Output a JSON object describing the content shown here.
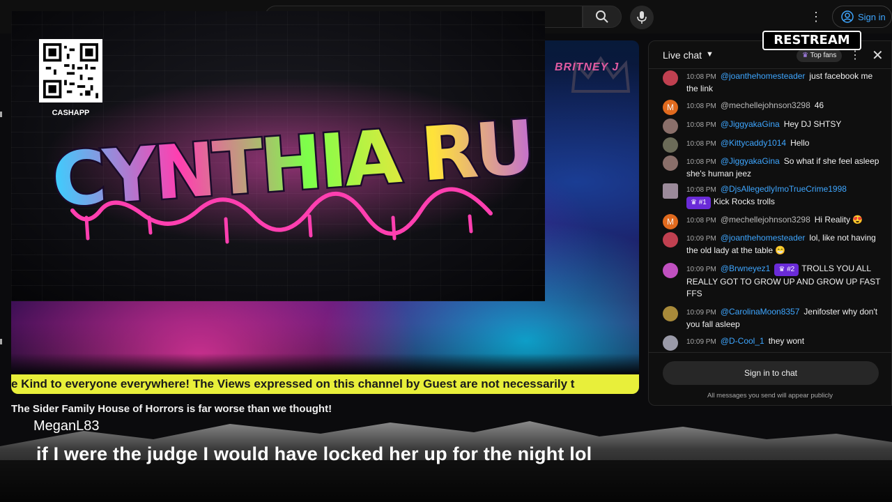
{
  "topbar": {
    "search_placeholder": "",
    "signin_label": "Sign in",
    "search_icon": "search-icon",
    "mic_icon": "mic-icon",
    "more_icon": "more-vert-icon",
    "user_icon": "user-circle-icon"
  },
  "overlay": {
    "title": "CYNTHIA RUSSO",
    "qr_label": "CASHAPP"
  },
  "video": {
    "corner_text": "BRITNEY J",
    "ticker": "e Kind to everyone everywhere! The Views expressed on this channel by Guest are not necessarily t",
    "title": "The Sider Family House of Horrors is far worse than we thought!"
  },
  "restream_logo": "RESTREAM",
  "chat": {
    "title": "Live chat",
    "top_fans_label": "Top fans",
    "signin_label": "Sign in to chat",
    "note": "All messages you send will appear publicly",
    "messages": [
      {
        "time": "10:08 PM",
        "author": "@joanthehomesteader",
        "text": "just facebook me the link",
        "avatar_color": "#c04050"
      },
      {
        "time": "10:08 PM",
        "author": "@mechellejohnson3298",
        "text": "46",
        "avatar_color": "#e06a1e",
        "initial": "M"
      },
      {
        "time": "10:08 PM",
        "author": "@JiggyakaGina",
        "text": "Hey DJ SHTSY",
        "avatar_color": "#8a6f6a"
      },
      {
        "time": "10:08 PM",
        "author": "@Kittycaddy1014",
        "text": "Hello",
        "avatar_color": "#6b6b58"
      },
      {
        "time": "10:08 PM",
        "author": "@JiggyakaGina",
        "text": "So what if she feel asleep she's human jeez",
        "avatar_color": "#8a6f6a"
      },
      {
        "time": "10:08 PM",
        "author": "@DjsAllegedlyImoTrueCrime1998",
        "badge": "#1",
        "text": "Kick Rocks  trolls",
        "avatar_color": "#9b8a9a"
      },
      {
        "time": "10:08 PM",
        "author": "@mechellejohnson3298",
        "text": "Hi Reality 😍",
        "avatar_color": "#e06a1e",
        "initial": "M"
      },
      {
        "time": "10:09 PM",
        "author": "@joanthehomesteader",
        "text": "lol, like not having the old lady at the table 😁",
        "avatar_color": "#c04050"
      },
      {
        "time": "10:09 PM",
        "author": "@Brwneyez1",
        "badge": "#2",
        "text": "TROLLS YOU ALL REALLY GOT TO GROW UP AND GROW UP FAST FFS",
        "avatar_color": "#c050c0"
      },
      {
        "time": "10:09 PM",
        "author": "@CarolinaMoon8357",
        "text": "Jenifoster why don't you fall asleep",
        "avatar_color": "#a88a3a"
      },
      {
        "time": "10:09 PM",
        "author": "@D-Cool_1",
        "text": "they wont",
        "avatar_color": "#9a9aa8"
      }
    ]
  },
  "comment": {
    "author": "MeganL83",
    "text": "if I were the judge I would have locked her up for the night lol"
  }
}
